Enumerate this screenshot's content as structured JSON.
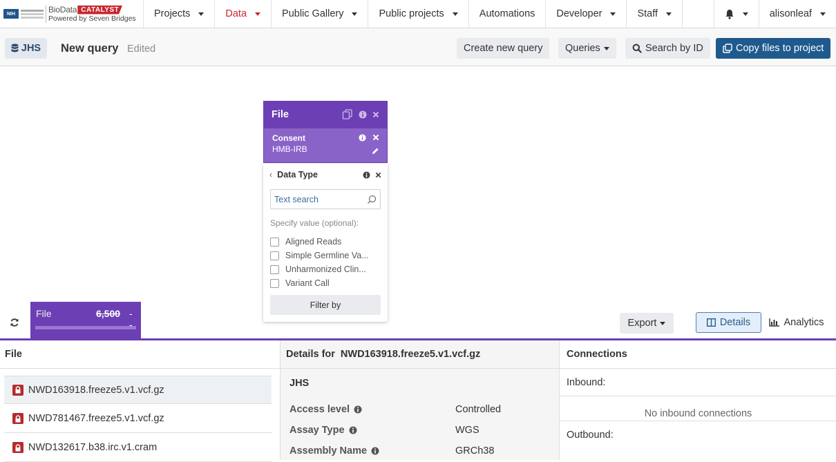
{
  "nav": {
    "logo": {
      "nih_text": "NIH",
      "bio": "BioData",
      "catalyst": "CATALYST",
      "powered": "Powered by Seven Bridges"
    },
    "items": [
      {
        "label": "Projects"
      },
      {
        "label": "Data"
      },
      {
        "label": "Public Gallery"
      },
      {
        "label": "Public projects"
      },
      {
        "label": "Automations"
      },
      {
        "label": "Developer"
      },
      {
        "label": "Staff"
      }
    ],
    "user": "alisonleaf"
  },
  "toolbar": {
    "dataset": "JHS",
    "query_title": "New query",
    "query_status": "Edited",
    "create_new_query": "Create new query",
    "queries": "Queries",
    "search_by_id": "Search by ID",
    "copy_files": "Copy files to project"
  },
  "node": {
    "title": "File",
    "filter_name": "Consent",
    "filter_value": "HMB-IRB"
  },
  "filter_panel": {
    "title": "Data Type",
    "search_placeholder": "Text search",
    "specify_label": "Specify value (optional):",
    "options": [
      {
        "label": "Aligned Reads",
        "checked": false
      },
      {
        "label": "Simple Germline Va...",
        "checked": false
      },
      {
        "label": "Unharmonized Clin...",
        "checked": false
      },
      {
        "label": "Variant Call",
        "checked": false
      }
    ],
    "filter_button": "Filter by"
  },
  "count_bar": {
    "label": "File",
    "count": "6,500",
    "pending": "- -"
  },
  "view": {
    "export": "Export",
    "details": "Details",
    "analytics": "Analytics"
  },
  "files_panel": {
    "header": "File",
    "rows": [
      {
        "name": "NWD163918.freeze5.v1.vcf.gz",
        "selected": true
      },
      {
        "name": "NWD781467.freeze5.v1.vcf.gz",
        "selected": false
      },
      {
        "name": "NWD132617.b38.irc.v1.cram",
        "selected": false
      }
    ]
  },
  "details_panel": {
    "header_prefix": "Details for",
    "file_name": "NWD163918.freeze5.v1.vcf.gz",
    "dataset": "JHS",
    "rows": [
      {
        "key": "Access level",
        "value": "Controlled"
      },
      {
        "key": "Assay Type",
        "value": "WGS"
      },
      {
        "key": "Assembly Name",
        "value": "GRCh38"
      }
    ]
  },
  "connections_panel": {
    "header": "Connections",
    "inbound_label": "Inbound:",
    "inbound_empty": "No inbound connections",
    "outbound_label": "Outbound:"
  },
  "colors": {
    "purple": "#6c3fb4",
    "brand_red": "#c8262f",
    "primary_blue": "#1e5a8e",
    "lock_red": "#b32d2e"
  }
}
